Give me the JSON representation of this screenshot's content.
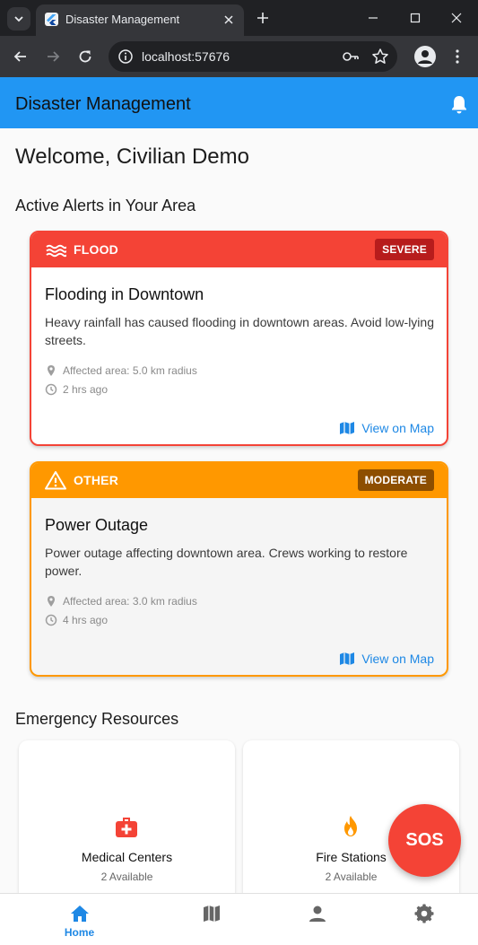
{
  "browser": {
    "tab_title": "Disaster Management",
    "url": "localhost:57676"
  },
  "appbar": {
    "title": "Disaster Management"
  },
  "welcome": "Welcome, Civilian Demo",
  "alerts_section_title": "Active Alerts in Your Area",
  "alerts": [
    {
      "type": "FLOOD",
      "severity": "SEVERE",
      "title": "Flooding in Downtown",
      "description": "Heavy rainfall has caused flooding in downtown areas. Avoid low-lying streets.",
      "affected_area": "Affected area: 5.0 km radius",
      "time_ago": "2 hrs ago",
      "map_link": "View on Map",
      "color": "#f44336"
    },
    {
      "type": "OTHER",
      "severity": "MODERATE",
      "title": "Power Outage",
      "description": "Power outage affecting downtown area. Crews working to restore power.",
      "affected_area": "Affected area: 3.0 km radius",
      "time_ago": "4 hrs ago",
      "map_link": "View on Map",
      "color": "#ff9800"
    }
  ],
  "resources_section_title": "Emergency Resources",
  "resources": [
    {
      "title": "Medical Centers",
      "count": "2 Available",
      "icon_color": "#f44336"
    },
    {
      "title": "Fire Stations",
      "count": "2 Available",
      "icon_color": "#ff9800"
    }
  ],
  "sos_label": "SOS",
  "bottom_nav": [
    {
      "label": "Home",
      "icon": "home-icon",
      "active": true
    },
    {
      "label": "",
      "icon": "map-icon",
      "active": false
    },
    {
      "label": "",
      "icon": "person-icon",
      "active": false
    },
    {
      "label": "",
      "icon": "gear-icon",
      "active": false
    }
  ],
  "colors": {
    "primary": "#2196f3",
    "severe": "#f44336",
    "moderate": "#ff9800",
    "link": "#1e88e5"
  }
}
